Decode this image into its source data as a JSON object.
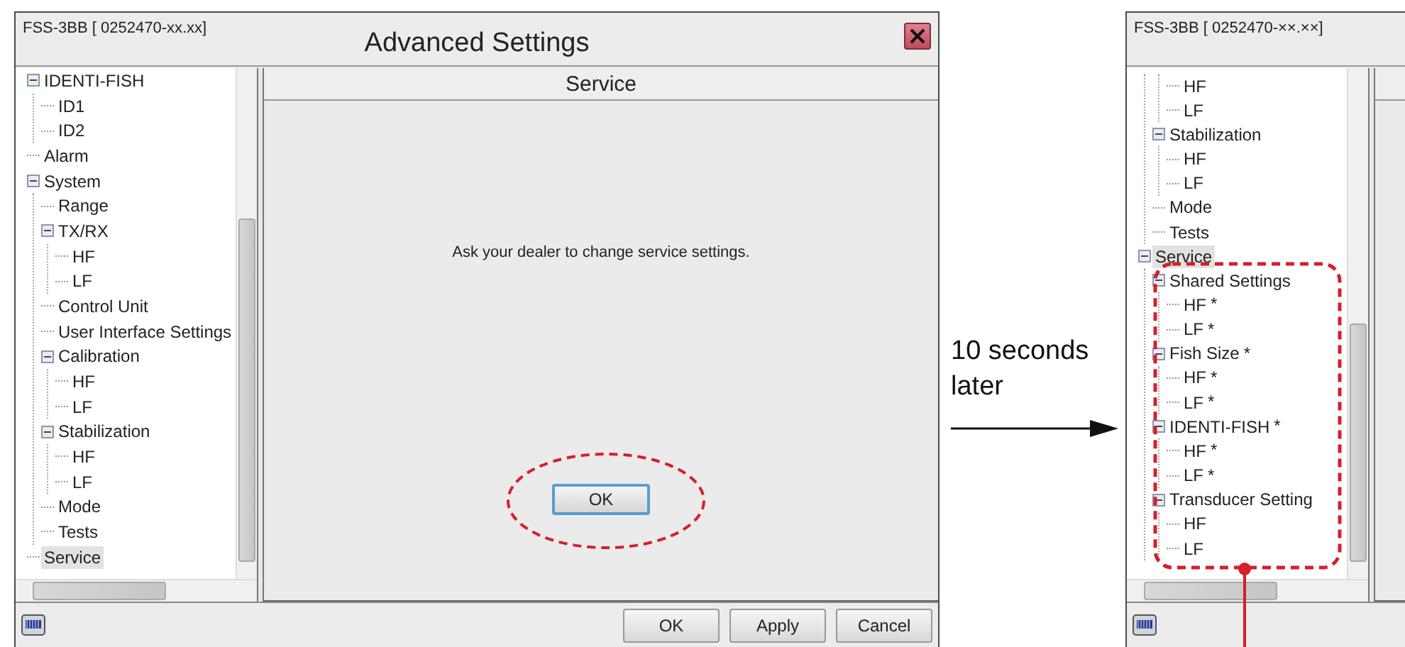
{
  "dialogs": [
    {
      "subtitle": "FSS-3BB [ 0252470-xx.xx]",
      "title": "Advanced Settings",
      "closable": true,
      "tree": [
        {
          "label": "IDENTI-FISH",
          "expanded": true,
          "selected": false,
          "children": [
            {
              "label": "ID1",
              "selected": false
            },
            {
              "label": "ID2",
              "selected": false
            }
          ]
        },
        {
          "label": "Alarm",
          "selected": false
        },
        {
          "label": "System",
          "expanded": true,
          "selected": false,
          "children": [
            {
              "label": "Range",
              "selected": false
            },
            {
              "label": "TX/RX",
              "expanded": true,
              "selected": false,
              "children": [
                {
                  "label": "HF",
                  "selected": false
                },
                {
                  "label": "LF",
                  "selected": false
                }
              ]
            },
            {
              "label": "Control Unit",
              "selected": false
            },
            {
              "label": "User Interface Settings",
              "selected": false
            },
            {
              "label": "Calibration",
              "expanded": true,
              "selected": false,
              "children": [
                {
                  "label": "HF",
                  "selected": false
                },
                {
                  "label": "LF",
                  "selected": false
                }
              ]
            },
            {
              "label": "Stabilization",
              "expanded": true,
              "selected": false,
              "children": [
                {
                  "label": "HF",
                  "selected": false
                },
                {
                  "label": "LF",
                  "selected": false
                }
              ]
            },
            {
              "label": "Mode",
              "selected": false
            },
            {
              "label": "Tests",
              "selected": false
            }
          ]
        },
        {
          "label": "Service",
          "selected": true
        }
      ],
      "panel": {
        "heading": "Service",
        "message": "Ask your dealer to change service settings.",
        "button": "OK"
      },
      "footer_buttons": [
        "OK",
        "Apply",
        "Cancel"
      ]
    },
    {
      "subtitle": "FSS-3BB [ 0252470-××.××]",
      "tree": [
        {
          "children": [
            {
              "children": [
                {
                  "label": "HF",
                  "selected": false
                },
                {
                  "label": "LF",
                  "selected": false
                }
              ]
            },
            {
              "label": "Stabilization",
              "expanded": true,
              "selected": false,
              "children": [
                {
                  "label": "HF",
                  "selected": false
                },
                {
                  "label": "LF",
                  "selected": false
                }
              ]
            },
            {
              "label": "Mode",
              "selected": false
            },
            {
              "label": "Tests",
              "selected": false
            }
          ]
        },
        {
          "label": "Service",
          "expanded": true,
          "selected": true,
          "children": [
            {
              "label": "Shared Settings",
              "expanded": true,
              "selected": false,
              "children": [
                {
                  "label": "HF",
                  "note": "*",
                  "selected": false
                },
                {
                  "label": "LF",
                  "note": "*",
                  "selected": false
                }
              ]
            },
            {
              "label": "Fish Size",
              "note": "*",
              "expanded": true,
              "selected": false,
              "children": [
                {
                  "label": "HF",
                  "note": "*",
                  "selected": false
                },
                {
                  "label": "LF",
                  "note": "*",
                  "selected": false
                }
              ]
            },
            {
              "label": "IDENTI-FISH",
              "note": "*",
              "expanded": true,
              "selected": false,
              "children": [
                {
                  "label": "HF",
                  "note": "*",
                  "selected": false
                },
                {
                  "label": "LF",
                  "note": "*",
                  "selected": false
                }
              ]
            },
            {
              "label": "Transducer Setting",
              "expanded": true,
              "selected": false,
              "children": [
                {
                  "label": "HF",
                  "selected": false
                },
                {
                  "label": "LF",
                  "selected": false
                }
              ]
            }
          ]
        }
      ]
    }
  ],
  "caption": "10 seconds later"
}
